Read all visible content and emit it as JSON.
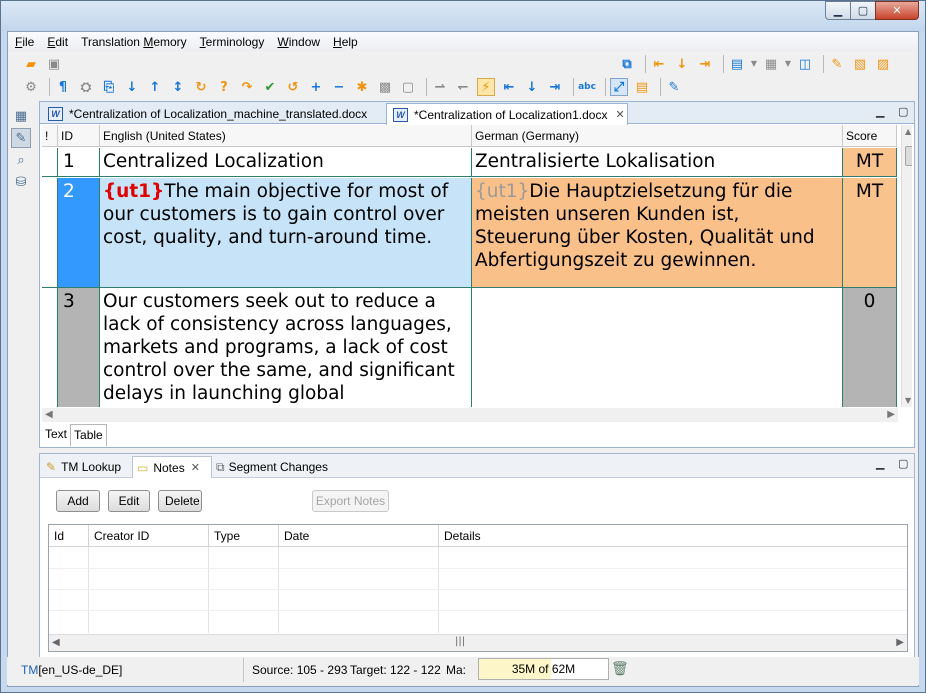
{
  "window": {
    "controls": {
      "minimize": "▁",
      "maximize": "▢",
      "close": "✕"
    }
  },
  "menubar": [
    {
      "label": "File",
      "u": "F",
      "rest": "ile"
    },
    {
      "label": "Edit",
      "u": "E",
      "rest": "dit"
    },
    {
      "label": "Translation Memory",
      "pre": "Translation ",
      "u": "M",
      "rest": "emory"
    },
    {
      "label": "Terminology",
      "u": "T",
      "rest": "erminology"
    },
    {
      "label": "Window",
      "u": "W",
      "rest": "indow"
    },
    {
      "label": "Help",
      "u": "H",
      "rest": "elp"
    }
  ],
  "editor": {
    "tabs": [
      {
        "label": "*Centralization of Localization_machine_translated.docx",
        "icon": "W",
        "active": false
      },
      {
        "label": "*Centralization of Localization1.docx",
        "icon": "W",
        "active": true
      }
    ],
    "columns": {
      "bang": "!",
      "id": "ID",
      "source": "English (United States)",
      "target": "German (Germany)",
      "score": "Score"
    },
    "rows": [
      {
        "id": "1",
        "source_tag": "",
        "source": "Centralized Localization",
        "target_tag": "",
        "target": "Zentralisierte Lokalisation",
        "score": "MT",
        "state": "mt"
      },
      {
        "id": "2",
        "source_tag": "{ut1}",
        "source": "The main objective for most of our customers is to gain control over cost, quality, and turn-around time.",
        "target_tag": "{ut1}",
        "target": "Die Hauptzielsetzung für die meisten unseren Kunden ist, Steuerung über Kosten, Qualität und Abfertigungszeit zu gewinnen.",
        "score": "MT",
        "state": "selected"
      },
      {
        "id": "3",
        "source_tag": "",
        "source": "Our customers seek out to reduce a lack of consistency across languages, markets and programs, a lack of cost control over the same, and significant delays in launching global",
        "target_tag": "",
        "target": "",
        "score": "0",
        "state": "untranslated"
      }
    ],
    "view_tabs": [
      "Text",
      "Table"
    ],
    "active_view": "Table"
  },
  "bottom_panel": {
    "tabs": [
      {
        "label": "TM Lookup",
        "active": false
      },
      {
        "label": "Notes",
        "active": true
      },
      {
        "label": "Segment Changes",
        "active": false
      }
    ],
    "buttons": {
      "add": "Add",
      "edit": "Edit",
      "delete": "Delete",
      "export": "Export Notes"
    },
    "columns": [
      "Id",
      "Creator ID",
      "Type",
      "Date",
      "Details"
    ],
    "rows": []
  },
  "statusbar": {
    "tm_prefix": "TM",
    "tm_locale": "[en_US-de_DE]",
    "source_label": "Source:",
    "source_range": "105 - 293",
    "target_label": "Target:",
    "target_range": "122 - 122",
    "ma_label": "Ma:",
    "heap_text": "35M of 62M",
    "heap_used_fraction": 0.56
  },
  "colors": {
    "mt_score_bg": "#f9c38e",
    "selected_source_bg": "#c6e3f7",
    "selected_target_bg": "#f9c08a",
    "selected_id_bg": "#3399ff",
    "untranslated_id_bg": "#b4b4b4",
    "row_border": "#2e7d6d",
    "tag_red": "#e00000"
  }
}
